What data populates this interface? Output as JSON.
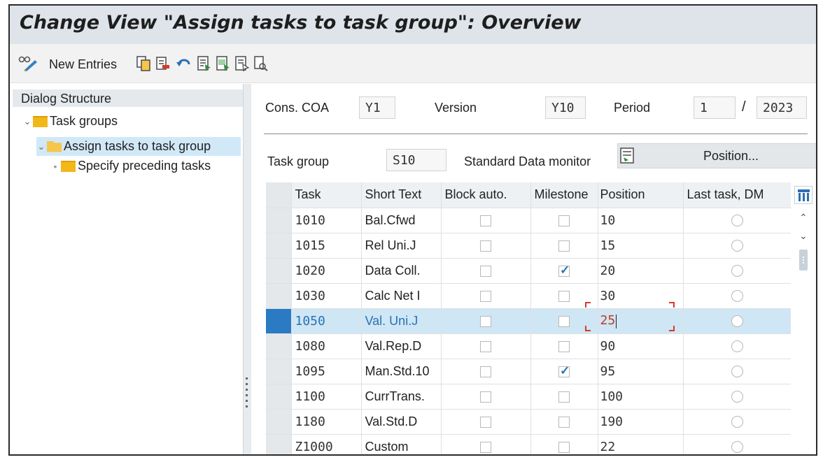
{
  "title": "Change View \"Assign tasks to task group\": Overview",
  "toolbar": {
    "new_entries": "New Entries",
    "icons": [
      "glasses-pencil-icon",
      "copy-icon",
      "delete-icon",
      "undo-icon",
      "select-all-icon",
      "select-block-icon",
      "deselect-all-icon",
      "print-icon"
    ]
  },
  "dialog": {
    "title": "Dialog Structure",
    "items": [
      {
        "label": "Task groups",
        "level": 0,
        "expanded": true,
        "selected": false
      },
      {
        "label": "Assign tasks to task group",
        "level": 1,
        "expanded": true,
        "selected": true
      },
      {
        "label": "Specify preceding tasks",
        "level": 2,
        "expanded": false,
        "selected": false
      }
    ]
  },
  "header": {
    "cons_coa_label": "Cons. COA",
    "cons_coa_value": "Y1",
    "version_label": "Version",
    "version_value": "Y10",
    "period_label": "Period",
    "period_value": "1",
    "period_sep": "/",
    "year_value": "2023",
    "task_group_label": "Task group",
    "task_group_value": "S10",
    "monitor_label": "Standard Data monitor",
    "position_button": "Position..."
  },
  "table": {
    "columns": [
      "Task",
      "Short Text",
      "Block auto.",
      "Milestone",
      "Position",
      "Last task, DM"
    ],
    "rows": [
      {
        "task": "1010",
        "short": "Bal.Cfwd",
        "block": false,
        "milestone": false,
        "position": "10",
        "last": false,
        "selected": false
      },
      {
        "task": "1015",
        "short": "Rel Uni.J",
        "block": false,
        "milestone": false,
        "position": "15",
        "last": false,
        "selected": false
      },
      {
        "task": "1020",
        "short": "Data Coll.",
        "block": false,
        "milestone": true,
        "position": "20",
        "last": false,
        "selected": false
      },
      {
        "task": "1030",
        "short": "Calc Net I",
        "block": false,
        "milestone": false,
        "position": "30",
        "last": false,
        "selected": false
      },
      {
        "task": "1050",
        "short": "Val. Uni.J",
        "block": false,
        "milestone": false,
        "position": "25",
        "last": false,
        "selected": true
      },
      {
        "task": "1080",
        "short": "Val.Rep.D",
        "block": false,
        "milestone": false,
        "position": "90",
        "last": false,
        "selected": false
      },
      {
        "task": "1095",
        "short": "Man.Std.10",
        "block": false,
        "milestone": true,
        "position": "95",
        "last": false,
        "selected": false
      },
      {
        "task": "1100",
        "short": "CurrTrans.",
        "block": false,
        "milestone": false,
        "position": "100",
        "last": false,
        "selected": false
      },
      {
        "task": "1180",
        "short": "Val.Std.D",
        "block": false,
        "milestone": false,
        "position": "190",
        "last": false,
        "selected": false
      },
      {
        "task": "Z1000",
        "short": "Custom",
        "block": false,
        "milestone": false,
        "position": "22",
        "last": false,
        "selected": false
      }
    ]
  },
  "colors": {
    "accent": "#2a7bc4",
    "title_bg": "#dee4ea",
    "selected_row": "#cfe6f5",
    "focus": "#d63a2a"
  }
}
